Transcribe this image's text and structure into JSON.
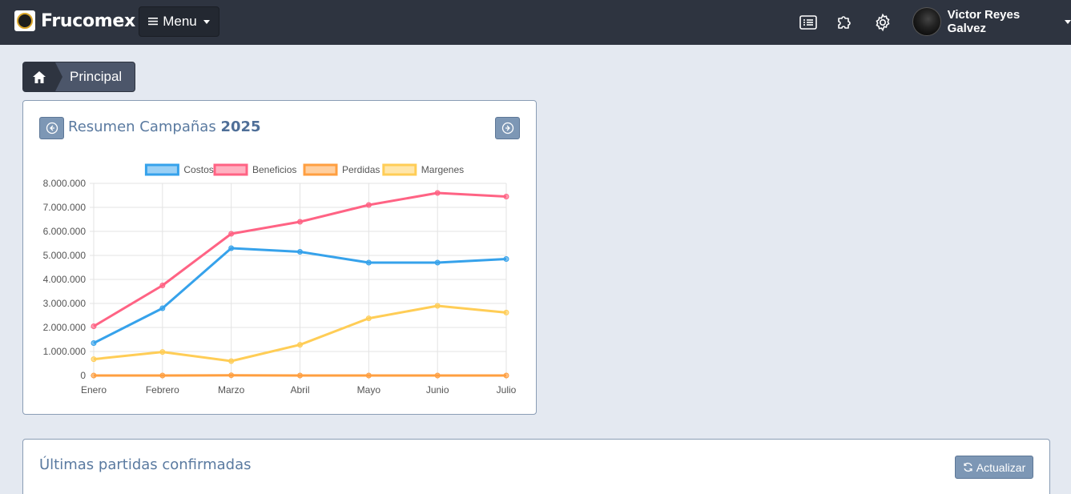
{
  "navbar": {
    "brand": "Frucomex",
    "menu_label": "Menu",
    "user_name": "Victor Reyes Galvez",
    "icons": [
      "list-icon",
      "puzzle-icon",
      "gear-icon"
    ]
  },
  "breadcrumb": {
    "label": "Principal"
  },
  "chart_card": {
    "title": "Resumen Campañas",
    "year": "2025"
  },
  "list_card": {
    "title": "Últimas partidas confirmadas",
    "refresh_label": "Actualizar"
  },
  "chart_data": {
    "type": "line",
    "categories": [
      "Enero",
      "Febrero",
      "Marzo",
      "Abril",
      "Mayo",
      "Junio",
      "Julio"
    ],
    "series": [
      {
        "name": "Costos",
        "color": "#36a2eb",
        "values": [
          1350000,
          2800000,
          5300000,
          5150000,
          4700000,
          4700000,
          4850000
        ]
      },
      {
        "name": "Beneficios",
        "color": "#ff6384",
        "values": [
          2050000,
          3750000,
          5900000,
          6400000,
          7100000,
          7600000,
          7450000
        ]
      },
      {
        "name": "Perdidas",
        "color": "#ff9f40",
        "values": [
          0,
          0,
          10000,
          0,
          0,
          0,
          0
        ]
      },
      {
        "name": "Margenes",
        "color": "#ffcd56",
        "values": [
          680000,
          980000,
          600000,
          1280000,
          2380000,
          2900000,
          2620000
        ]
      }
    ],
    "ylim": [
      0,
      8000000
    ],
    "yticks": [
      "8.000.000",
      "7.000.000",
      "6.000.000",
      "5.000.000",
      "4.000.000",
      "3.000.000",
      "2.000.000",
      "1.000.000",
      "0"
    ],
    "grid": true,
    "legend": "top"
  }
}
